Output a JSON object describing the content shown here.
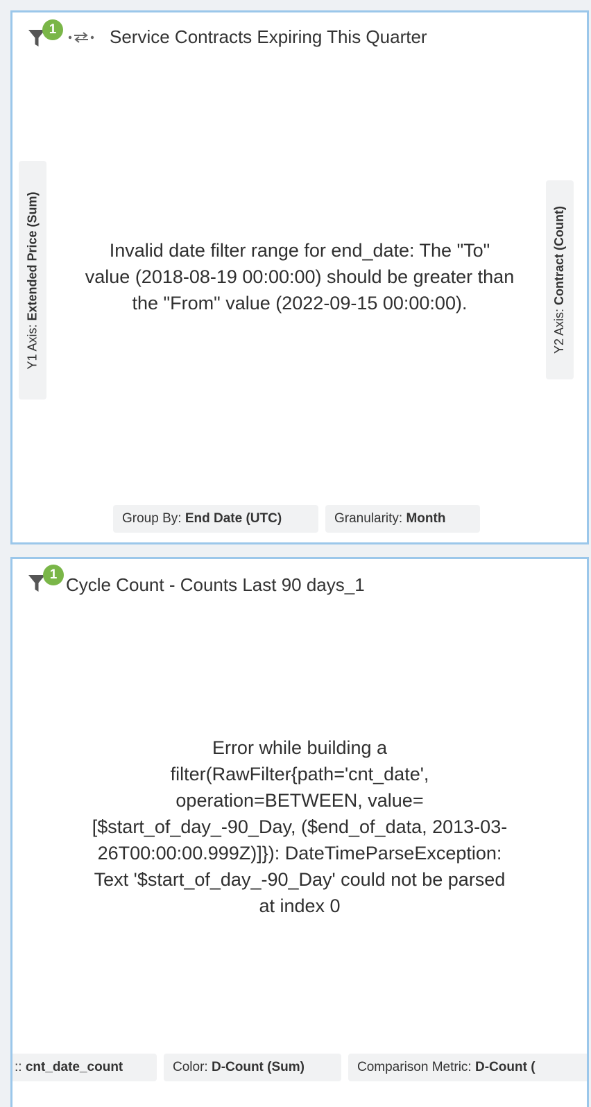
{
  "widget1": {
    "title": "Service Contracts Expiring This Quarter",
    "filter_count": "1",
    "error_lines": [
      "Invalid date filter range for end_date: The \"To\"",
      "value (2018-08-19 00:00:00) should be greater than",
      "the \"From\" value (2022-09-15 00:00:00)."
    ],
    "y1_axis": {
      "label": "Y1 Axis:",
      "value": "Extended Price (Sum)"
    },
    "y2_axis": {
      "label": "Y2 Axis:",
      "value": "Contract (Count)"
    },
    "group_by": {
      "label": "Group By:",
      "value": "End Date (UTC)"
    },
    "granularity": {
      "label": "Granularity:",
      "value": "Month"
    }
  },
  "widget2": {
    "title": "Cycle Count - Counts Last 90 days_1",
    "filter_count": "1",
    "error_lines": [
      "Error while building a",
      "filter(RawFilter{path='cnt_date',",
      "operation=BETWEEN, value=",
      "[$start_of_day_-90_Day, ($end_of_data, 2013-03-",
      "26T00:00:00.999Z)]}): DateTimeParseException:",
      "Text '$start_of_day_-90_Day' could not be parsed",
      "at index 0"
    ],
    "metric_pill": {
      "label": "::",
      "value": "cnt_date_count"
    },
    "color_pill": {
      "label": "Color:",
      "value": "D-Count (Sum)"
    },
    "comparison_pill": {
      "label": "Comparison Metric:",
      "value": "D-Count ("
    }
  },
  "colors": {
    "badge": "#7ab648",
    "border": "#9bc7ea",
    "icon": "#555555"
  },
  "icons": {
    "filter": "filter-icon",
    "swap": "swap-arrows-icon"
  }
}
